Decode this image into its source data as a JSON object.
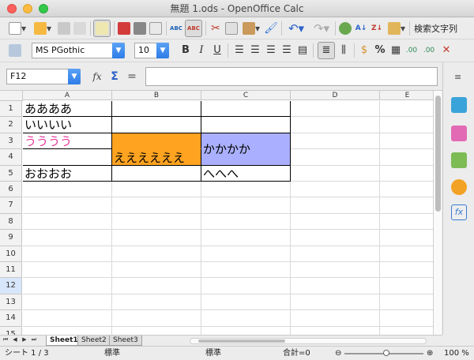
{
  "window": {
    "title": "無題 1.ods - OpenOffice Calc"
  },
  "toolbar": {
    "find_text": "検索文字列"
  },
  "formatting": {
    "font_name": "MS PGothic",
    "font_size": "10",
    "bold": "B",
    "italic": "I",
    "underline": "U"
  },
  "formula_bar": {
    "name_box": "F12",
    "function_icon": "𝑓x",
    "sum_icon": "Σ",
    "equals_icon": "=",
    "formula": ""
  },
  "columns": [
    "A",
    "B",
    "C",
    "D",
    "E"
  ],
  "rows": [
    "1",
    "2",
    "3",
    "4",
    "5",
    "6",
    "7",
    "8",
    "9",
    "10",
    "11",
    "12",
    "13",
    "14",
    "15"
  ],
  "selected_row": "12",
  "cells": {
    "a1": "ああああ",
    "a2": "いいいい",
    "a3": "うううう",
    "b4": "ええええええ",
    "c3": "かかかか",
    "a5": "おおおお",
    "c5": "へへへ"
  },
  "colors": {
    "a3_text": "#e5399a",
    "b34_fill": "#ffa320",
    "c3_fill": "#aab0ff"
  },
  "sheets": [
    {
      "label": "Sheet1"
    },
    {
      "label": "Sheet2"
    },
    {
      "label": "Sheet3"
    }
  ],
  "status": {
    "sheet": "シート 1 / 3",
    "style": "標準",
    "mode": "標準",
    "sum": "合計=0",
    "zoom": "100 %",
    "zoom_minus": "⊖",
    "zoom_plus": "⊕"
  }
}
